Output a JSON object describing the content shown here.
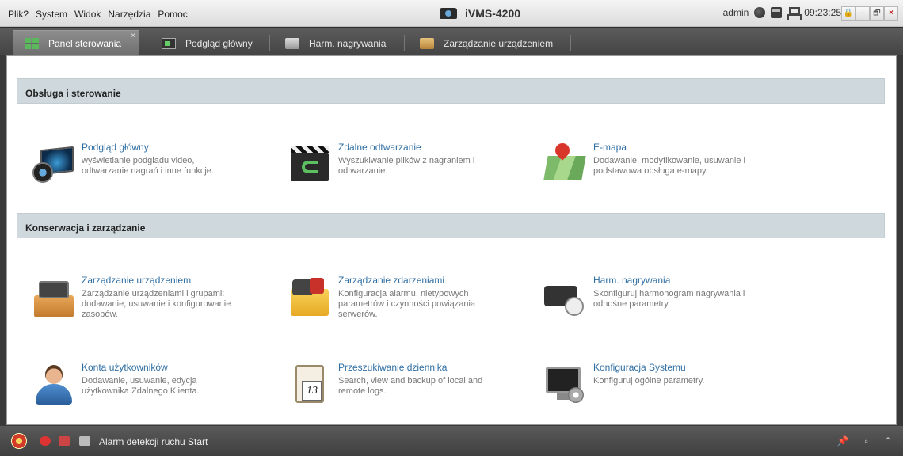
{
  "menu": [
    "Plik?",
    "System",
    "Widok",
    "Narzędzia",
    "Pomoc"
  ],
  "app_title": "iVMS-4200",
  "status": {
    "user": "admin",
    "time": "09:23:25"
  },
  "window_buttons": {
    "lock": "🔒",
    "minimize": "–",
    "restore": "🗗",
    "close": "×"
  },
  "tabs": [
    {
      "label": "Panel sterowania",
      "close": "×"
    },
    {
      "label": "Podgląd główny"
    },
    {
      "label": "Harm. nagrywania"
    },
    {
      "label": "Zarządzanie urządzeniem"
    }
  ],
  "sections": {
    "operation": "Obsługa i sterowanie",
    "maintenance": "Konserwacja i zarządzanie"
  },
  "items": {
    "main_view": {
      "title": "Podgląd główny",
      "desc": "wyświetlanie podglądu video, odtwarzanie nagrań i inne funkcje."
    },
    "remote_playback": {
      "title": "Zdalne odtwarzanie",
      "desc": "Wyszukiwanie plików z nagraniem i odtwarzanie."
    },
    "emap": {
      "title": "E-mapa",
      "desc": "Dodawanie, modyfikowanie, usuwanie i podstawowa obsługa e-mapy."
    },
    "device_mgmt": {
      "title": "Zarządzanie urządzeniem",
      "desc": "Zarządzanie urządzeniami i grupami: dodawanie, usuwanie i konfigurowanie zasobów."
    },
    "event_mgmt": {
      "title": "Zarządzanie zdarzeniami",
      "desc": "Konfiguracja alarmu, nietypowych parametrów i czynności powiązania serwerów."
    },
    "record_schedule": {
      "title": "Harm. nagrywania",
      "desc": "Skonfiguruj harmonogram nagrywania i odnośne parametry."
    },
    "user_accounts": {
      "title": "Konta użytkowników",
      "desc": "Dodawanie, usuwanie, edycja użytkownika Zdalnego Klienta."
    },
    "log_search": {
      "title": "Przeszukiwanie dziennika",
      "desc": "Search, view and backup of local and remote logs.",
      "calendar_day": "13"
    },
    "system_config": {
      "title": "Konfiguracja Systemu",
      "desc": "Konfiguruj ogólne parametry."
    }
  },
  "statusbar": {
    "alarm_text": "Alarm detekcji ruchu Start",
    "pin": "📌",
    "restore": "▫",
    "collapse": "⌃"
  }
}
